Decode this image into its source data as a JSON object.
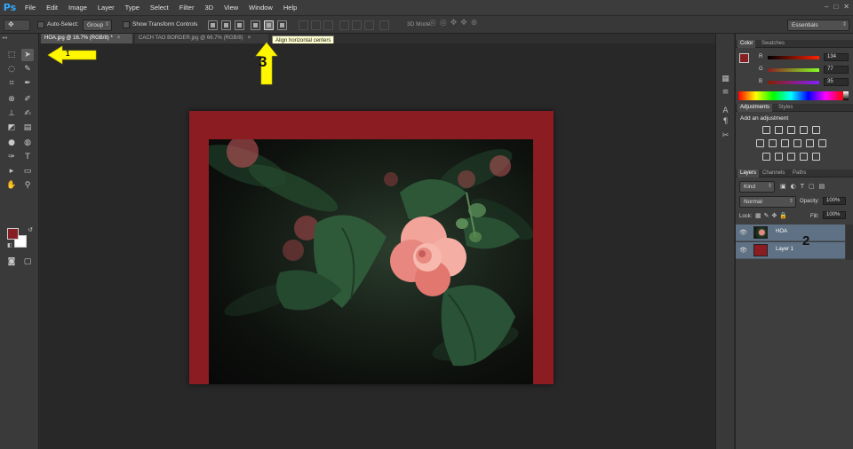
{
  "app": {
    "logo": "Ps"
  },
  "menu": [
    "File",
    "Edit",
    "Image",
    "Layer",
    "Type",
    "Select",
    "Filter",
    "3D",
    "View",
    "Window",
    "Help"
  ],
  "options_bar": {
    "auto_select_label": "Auto-Select:",
    "auto_select_value": "Group",
    "show_transform_label": "Show Transform Controls",
    "mode_3d_label": "3D Mode:",
    "workspace": "Essentials"
  },
  "tabs": [
    {
      "label": "HOA.jpg @ 16.7% (RGB/8) *",
      "active": true
    },
    {
      "label": "CACH TAO BORDER.jpg @ 66.7% (RGB/8)",
      "active": false
    }
  ],
  "tooltip": "Align horizontal centers",
  "colors": {
    "foreground": "#861f24",
    "background": "#ffffff",
    "border_red": "#8a1c22",
    "layer_highlight": "#5f7184",
    "annotation_yellow": "#fff700"
  },
  "color_panel": {
    "tabs": [
      "Color",
      "Swatches"
    ],
    "channels": [
      {
        "label": "R",
        "value": "134"
      },
      {
        "label": "G",
        "value": "77"
      },
      {
        "label": "B",
        "value": "35"
      }
    ]
  },
  "adjustments_panel": {
    "tabs": [
      "Adjustments",
      "Styles"
    ],
    "heading": "Add an adjustment"
  },
  "layers_panel": {
    "tabs": [
      "Layers",
      "Channels",
      "Paths"
    ],
    "filter_kind": "Kind",
    "blend_mode": "Normal",
    "opacity_label": "Opacity:",
    "opacity_value": "100%",
    "lock_label": "Lock:",
    "fill_label": "Fill:",
    "fill_value": "100%",
    "layers": [
      {
        "name": "HOA",
        "thumb": "photo"
      },
      {
        "name": "Layer 1",
        "thumb": "red"
      }
    ]
  },
  "annotations": {
    "step1": "1",
    "step2": "2",
    "step3": "3"
  }
}
